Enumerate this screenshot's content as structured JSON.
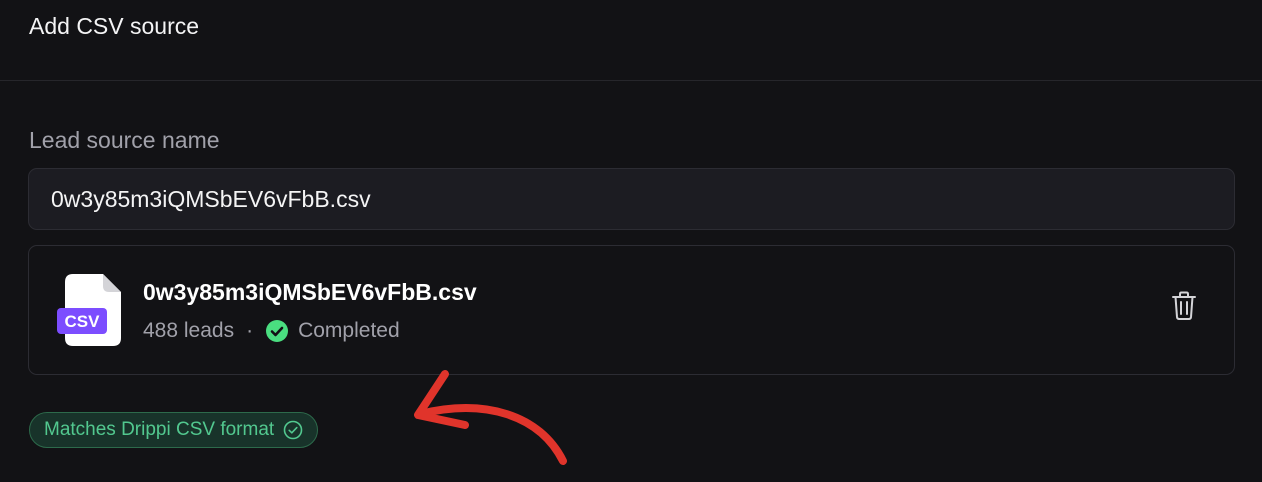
{
  "header": {
    "title": "Add CSV source"
  },
  "form": {
    "lead_source_label": "Lead source name",
    "lead_source_value": "0w3y85m3iQMSbEV6vFbB.csv"
  },
  "file_card": {
    "file_type_label": "CSV",
    "file_name": "0w3y85m3iQMSbEV6vFbB.csv",
    "leads_count": "488 leads",
    "separator": "·",
    "status": "Completed",
    "status_icon": "check-circle-icon",
    "delete_icon": "trash-icon"
  },
  "badge": {
    "label": "Matches Drippi CSV format",
    "icon": "check-circle-outline-icon"
  },
  "colors": {
    "background": "#121215",
    "accent_purple": "#7c4dff",
    "success_green": "#4ade80",
    "badge_text": "#52c88f",
    "annotation_red": "#e0342b"
  },
  "annotation": {
    "type": "red-curved-arrow"
  }
}
